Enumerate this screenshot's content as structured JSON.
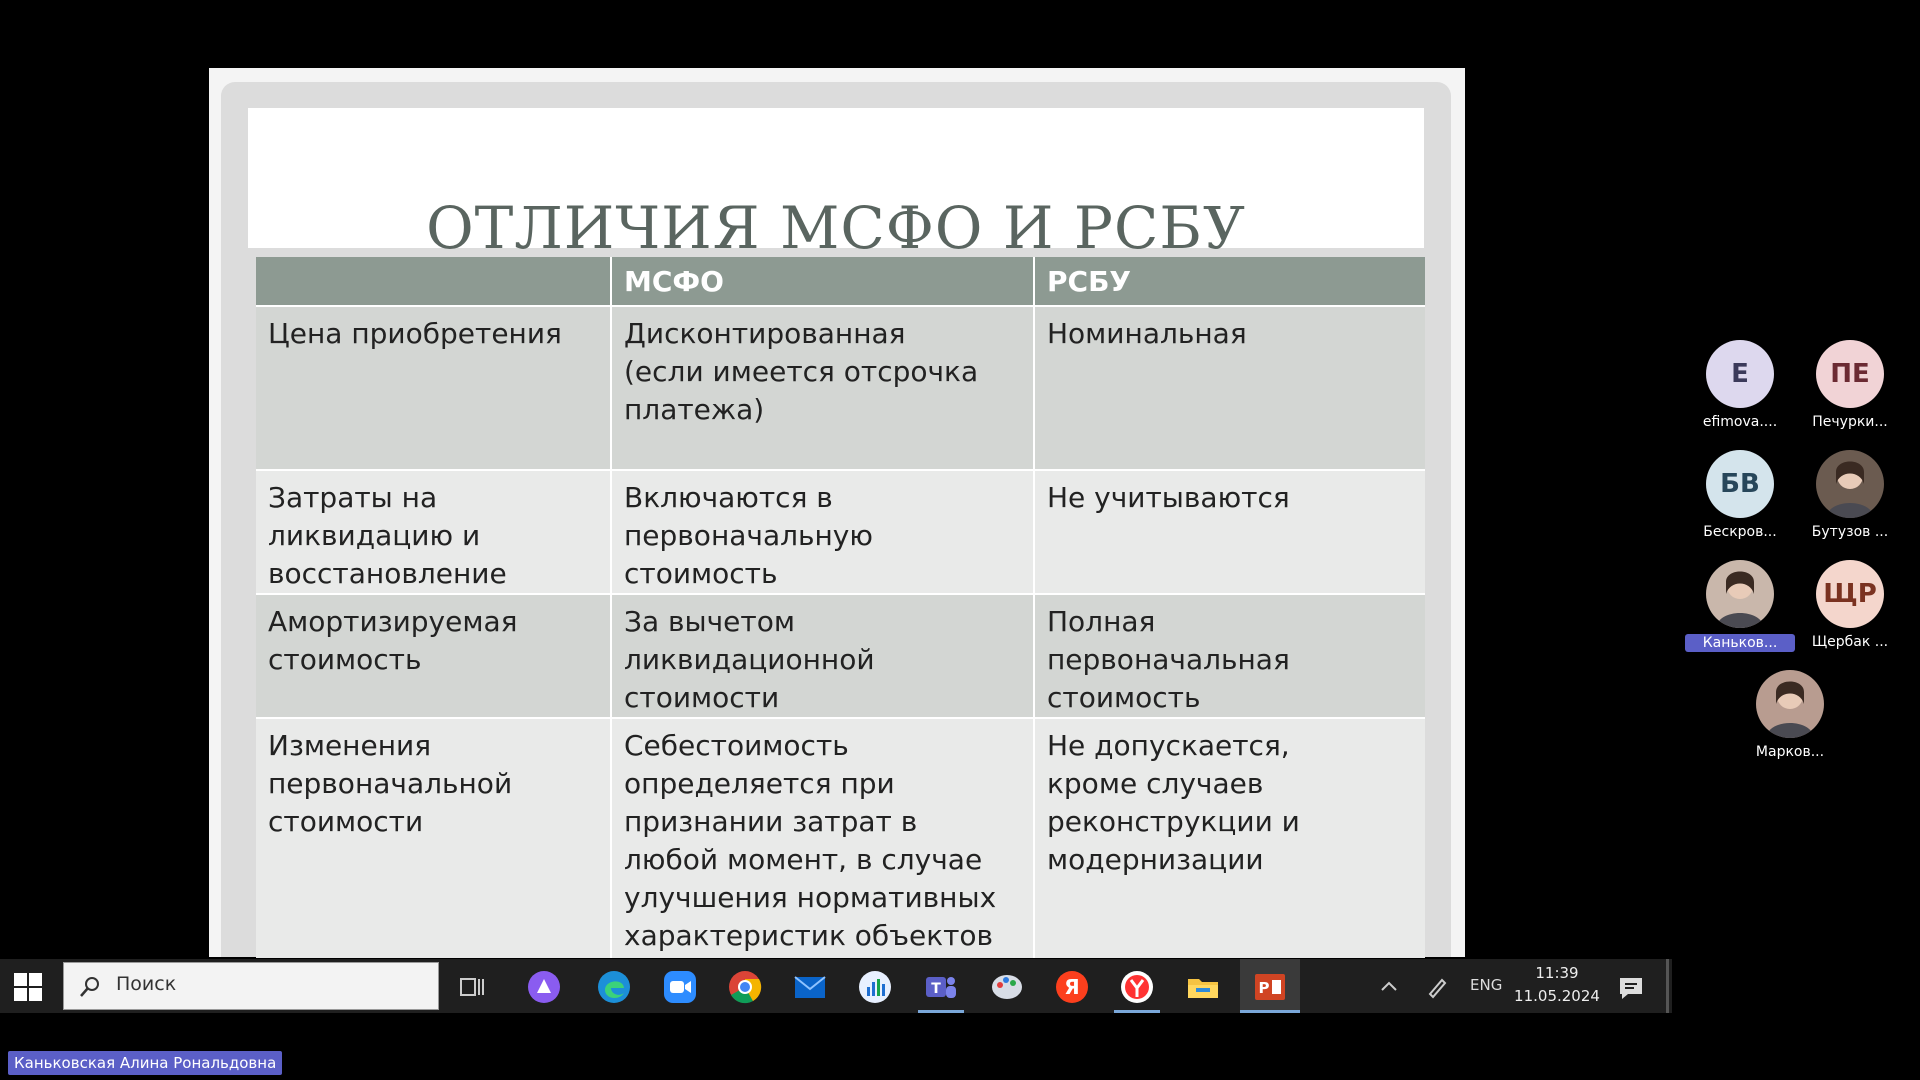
{
  "slide": {
    "title": "ОТЛИЧИЯ МСФО И РСБУ",
    "table": {
      "headers": [
        "",
        "МСФО",
        "РСБУ"
      ],
      "rows": [
        {
          "criterion": [
            "Цена приобретения"
          ],
          "ifrs": [
            "Дисконтированная",
            "(если имеется отсрочка",
            "платежа)"
          ],
          "ras": [
            "Номинальная"
          ]
        },
        {
          "criterion": [
            "Затраты на",
            "ликвидацию и",
            "восстановление"
          ],
          "ifrs": [
            "Включаются в",
            "первоначальную",
            "стоимость"
          ],
          "ras": [
            "Не учитываются"
          ]
        },
        {
          "criterion": [
            "Амортизируемая",
            "стоимость"
          ],
          "ifrs": [
            "За вычетом",
            "ликвидационной",
            "стоимости"
          ],
          "ras": [
            "Полная",
            "первоначальная",
            "стоимость"
          ]
        },
        {
          "criterion": [
            "Изменения",
            "первоначальной",
            "стоимости"
          ],
          "ifrs": [
            "Себестоимость",
            "определяется при",
            "признании затрат в",
            "любой момент, в случае",
            "улучшения нормативных",
            "характеристик объектов"
          ],
          "ras": [
            "Не допускается,",
            "кроме случаев",
            "реконструкции и",
            "модернизации"
          ]
        }
      ]
    }
  },
  "participants": [
    {
      "initials": "E",
      "name": "efimova....",
      "bg": "#ddd8ee",
      "fg": "#3b3a5a",
      "photo": false
    },
    {
      "initials": "ПЕ",
      "name": "Печурки...",
      "bg": "#f1d3d6",
      "fg": "#6b2a33",
      "photo": false
    },
    {
      "initials": "БВ",
      "name": "Бескров...",
      "bg": "#d4e4ec",
      "fg": "#27465a",
      "photo": false
    },
    {
      "initials": "",
      "name": "Бутузов ...",
      "bg": "#6b5b50",
      "fg": "#ffffff",
      "photo": true
    },
    {
      "initials": "",
      "name": "Каньков...",
      "bg": "#c9b7ab",
      "fg": "#ffffff",
      "photo": true,
      "active": true
    },
    {
      "initials": "ЩР",
      "name": "Щербак ...",
      "bg": "#f4d6cc",
      "fg": "#7a3220",
      "photo": false
    },
    {
      "initials": "",
      "name": "Марков...",
      "bg": "#b89c90",
      "fg": "#ffffff",
      "photo": true
    }
  ],
  "taskbar": {
    "search_placeholder": "Поиск",
    "apps": [
      "task-view-icon",
      "alice-icon",
      "edge-icon",
      "zoom-icon",
      "chrome-icon",
      "mail-icon",
      "stats-app-icon",
      "teams-icon",
      "paint-icon",
      "yandex-browser-icon",
      "yandex-icon",
      "file-explorer-icon",
      "powerpoint-icon"
    ],
    "language": "ENG",
    "time": "11:39",
    "date": "11.05.2024"
  },
  "speaker_label": "Каньковская Алина Рональдовна"
}
